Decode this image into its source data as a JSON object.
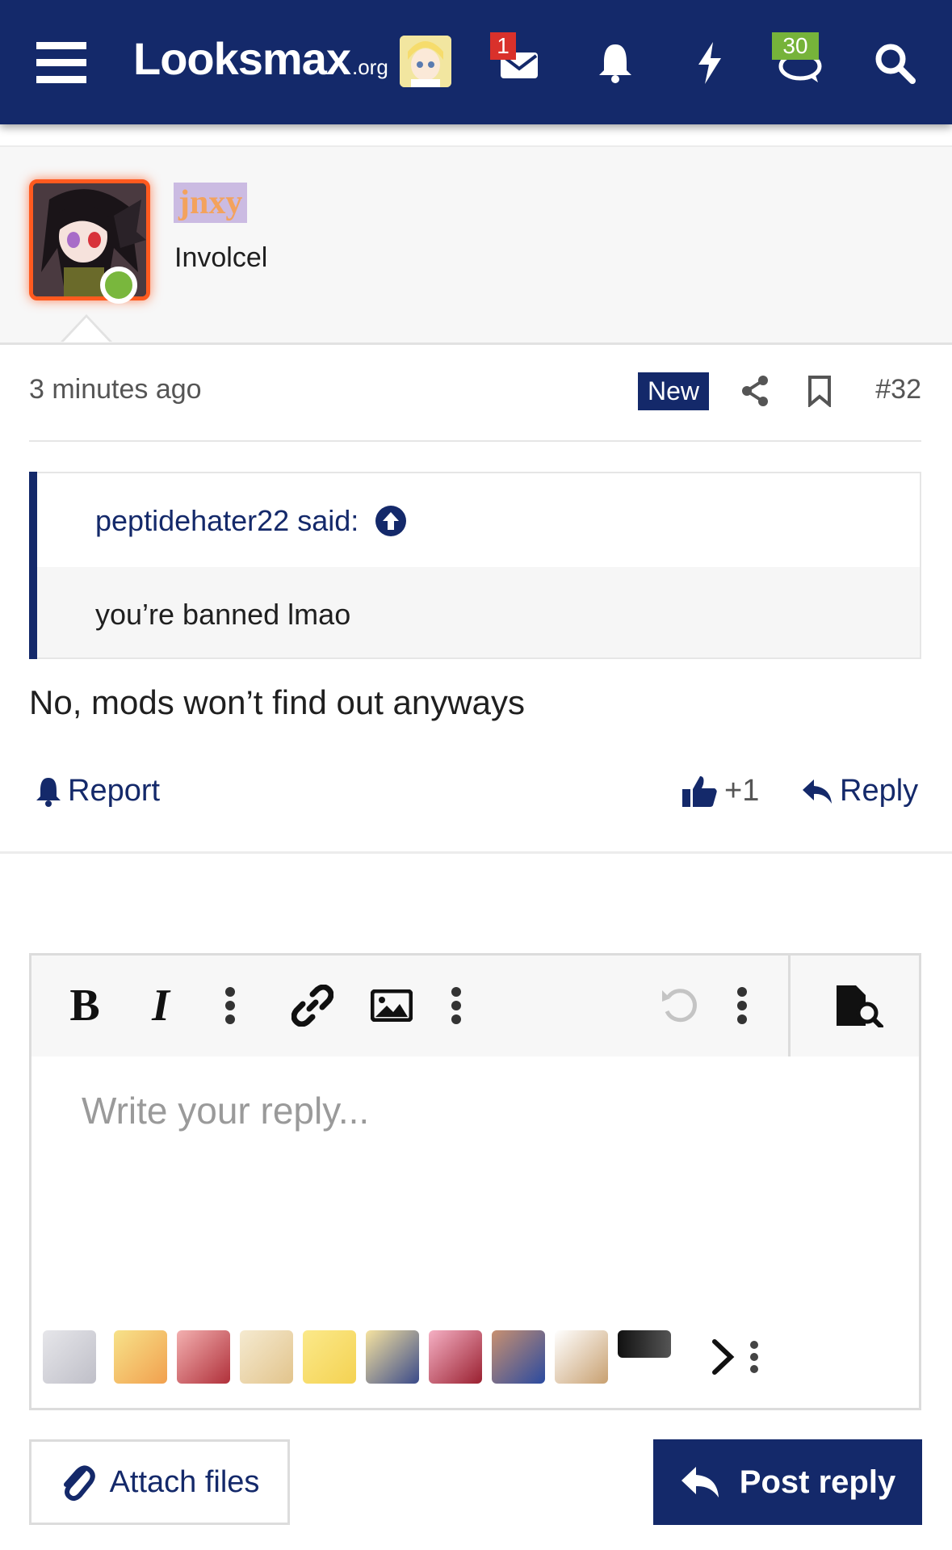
{
  "nav": {
    "logo_main": "Looksmax",
    "logo_tld": ".org",
    "inbox_badge": "1",
    "alerts_badge": "30"
  },
  "post": {
    "username": "jnxy",
    "user_title": "Involcel",
    "time": "3 minutes ago",
    "new_label": "New",
    "post_number": "#32",
    "quote_author": "peptidehater22 said:",
    "quote_text": "you’re banned lmao",
    "message": "No, mods won’t find out anyways",
    "report_label": "Report",
    "like_count": "+1",
    "reply_label": "Reply"
  },
  "editor": {
    "placeholder": "Write your reply..."
  },
  "buttons": {
    "attach_label": "Attach files",
    "post_label": "Post reply"
  },
  "colors": {
    "brand": "#14296a",
    "online": "#79b73d",
    "badge_red": "#d9312b",
    "badge_green": "#76b33a"
  }
}
